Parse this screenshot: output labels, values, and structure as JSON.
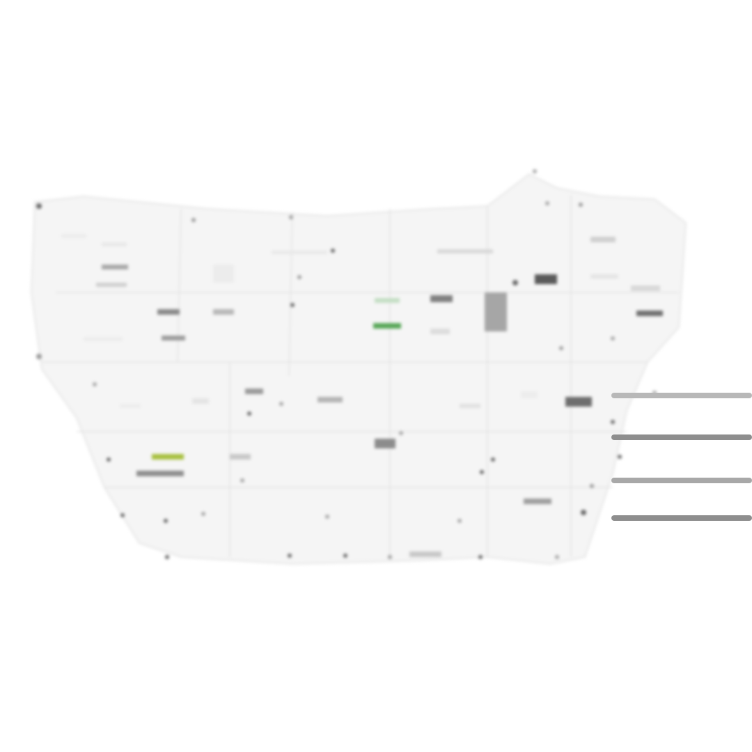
{
  "map": {
    "land_color": "#f5f5f5",
    "border_color": "#d4d4d4",
    "label_color": "#8a8a8a",
    "label_dark_color": "#5a5a5a",
    "highlight_green": "#5aa85a",
    "highlight_yellow_green": "#a8c040",
    "water_color": "#ffffff"
  },
  "legend": {
    "line_color": "#8e8e8e",
    "entries": [
      "",
      "",
      "",
      ""
    ]
  }
}
